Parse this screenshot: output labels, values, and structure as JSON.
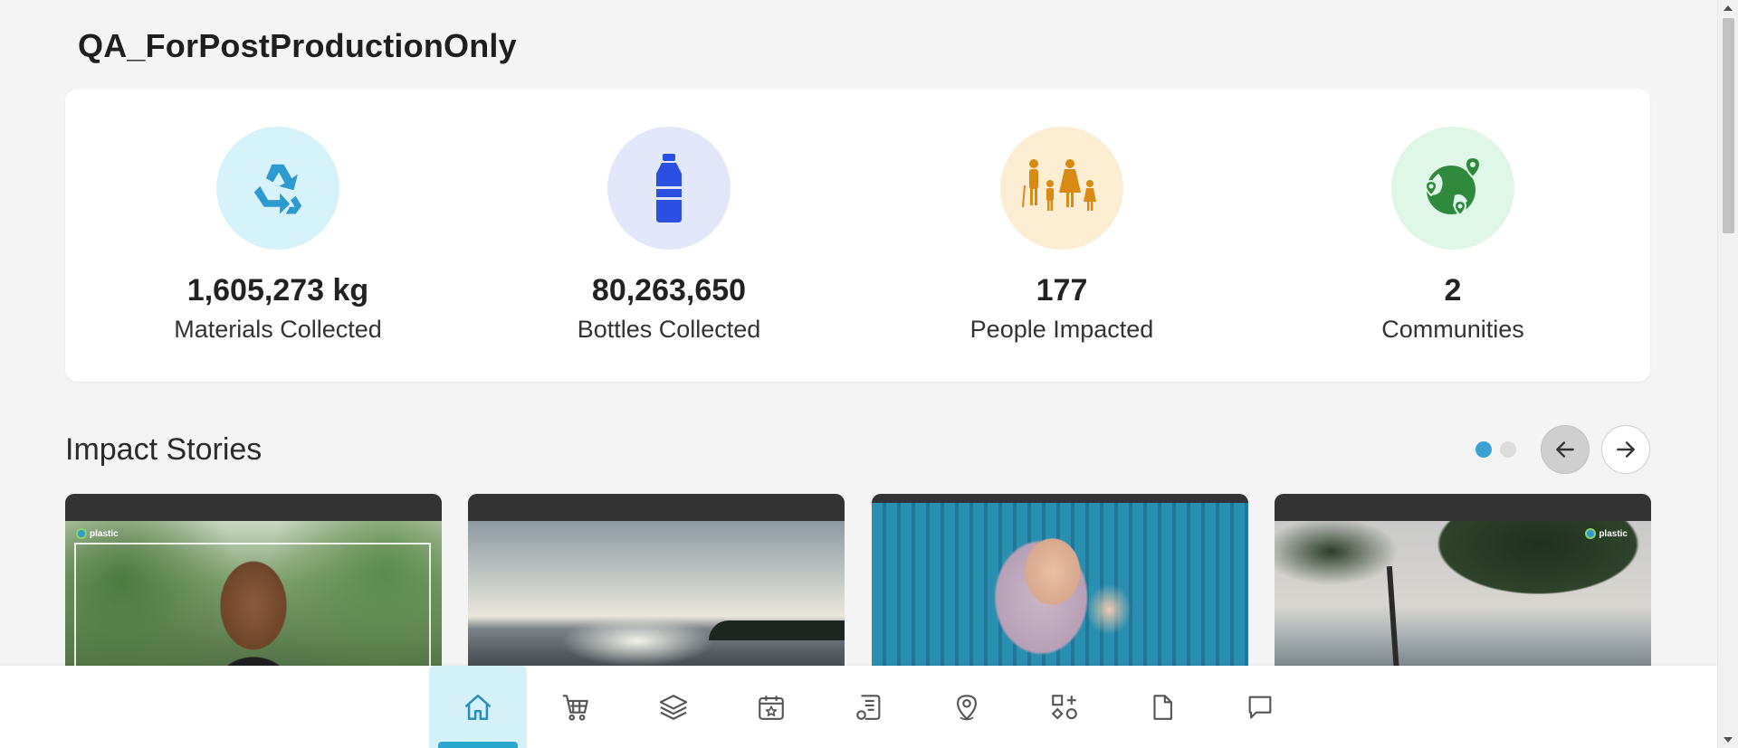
{
  "page": {
    "title": "QA_ForPostProductionOnly"
  },
  "stats": [
    {
      "value": "1,605,273 kg",
      "label": "Materials Collected",
      "icon": "recycle-icon",
      "circle_color": "#d6f3fc",
      "icon_color": "#2d9bd0"
    },
    {
      "value": "80,263,650",
      "label": "Bottles Collected",
      "icon": "bottle-icon",
      "circle_color": "#e2e7fb",
      "icon_color": "#2b4fe0"
    },
    {
      "value": "177",
      "label": "People Impacted",
      "icon": "family-icon",
      "circle_color": "#fdeed3",
      "icon_color": "#d88a12"
    },
    {
      "value": "2",
      "label": "Communities",
      "icon": "globe-pins-icon",
      "circle_color": "#dff7e6",
      "icon_color": "#2f8a3d"
    }
  ],
  "impact_stories": {
    "title": "Impact Stories",
    "pagination": {
      "pages": 2,
      "active": 1
    },
    "stories": [
      {
        "image": "woman-portrait-photo"
      },
      {
        "image": "ocean-sunset-photo"
      },
      {
        "image": "mother-child-photo"
      },
      {
        "image": "beach-tree-photo"
      }
    ]
  },
  "bottom_nav": {
    "active": "home",
    "items": [
      {
        "name": "home",
        "icon": "home-icon"
      },
      {
        "name": "cart",
        "icon": "cart-icon"
      },
      {
        "name": "layers",
        "icon": "layers-icon"
      },
      {
        "name": "events",
        "icon": "calendar-star-icon"
      },
      {
        "name": "reports",
        "icon": "report-icon"
      },
      {
        "name": "locations",
        "icon": "map-pin-icon"
      },
      {
        "name": "apps",
        "icon": "apps-icon"
      },
      {
        "name": "documents",
        "icon": "document-icon"
      },
      {
        "name": "messages",
        "icon": "chat-icon"
      }
    ]
  },
  "colors": {
    "accent": "#2aa7cf",
    "background": "#f4f4f4"
  }
}
